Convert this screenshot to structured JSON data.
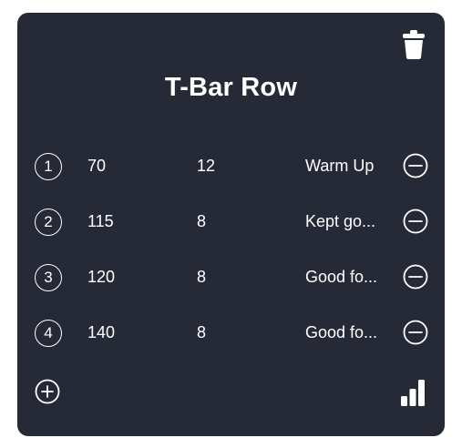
{
  "exercise": {
    "title": "T-Bar Row"
  },
  "sets": [
    {
      "number": "1",
      "weight": "70",
      "reps": "12",
      "note": "Warm Up"
    },
    {
      "number": "2",
      "weight": "115",
      "reps": "8",
      "note": "Kept go..."
    },
    {
      "number": "3",
      "weight": "120",
      "reps": "8",
      "note": "Good fo..."
    },
    {
      "number": "4",
      "weight": "140",
      "reps": "8",
      "note": "Good fo..."
    }
  ],
  "icons": {
    "delete": "trash-icon",
    "remove_set": "minus-circle-icon",
    "add_set": "plus-circle-icon",
    "stats": "bar-chart-icon"
  },
  "colors": {
    "card": "#262a36",
    "text": "#ffffff"
  }
}
